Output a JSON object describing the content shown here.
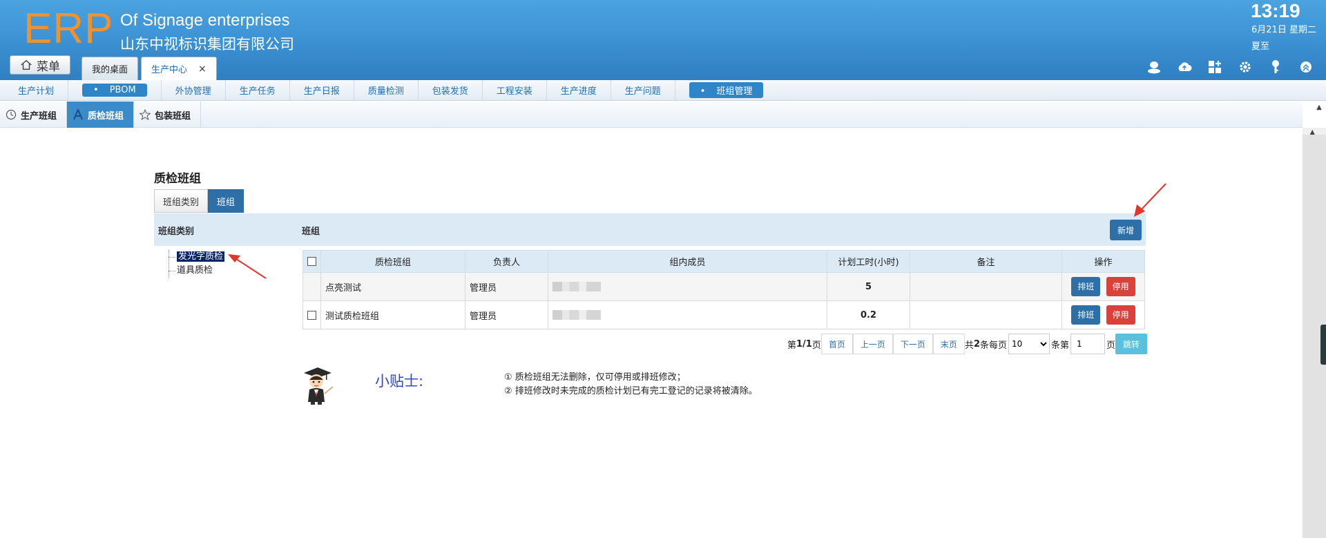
{
  "header": {
    "logo": "ERP",
    "company_en": "Of Signage enterprises",
    "company_cn": "山东中视标识集团有限公司",
    "time": "13:19",
    "date": "6月21日 星期二",
    "solar_term": "夏至"
  },
  "menu_button": {
    "label": "菜单",
    "icon": "home-icon"
  },
  "tabs": [
    {
      "label": "我的桌面",
      "active": false
    },
    {
      "label": "生产中心",
      "active": true,
      "closable": true,
      "close_glyph": "×"
    }
  ],
  "tool_icons": [
    "user-icon",
    "cloud-upload-icon",
    "grid-add-icon",
    "gear-icon",
    "key-icon",
    "collapse-up-icon"
  ],
  "module_nav": [
    {
      "label": "生产计划",
      "active": false
    },
    {
      "label": "PBOM",
      "active": true
    },
    {
      "label": "外协管理",
      "active": false
    },
    {
      "label": "生产任务",
      "active": false
    },
    {
      "label": "生产日报",
      "active": false
    },
    {
      "label": "质量检测",
      "active": false
    },
    {
      "label": "包装发货",
      "active": false
    },
    {
      "label": "工程安装",
      "active": false
    },
    {
      "label": "生产进度",
      "active": false
    },
    {
      "label": "生产问题",
      "active": false
    },
    {
      "label": "班组管理",
      "active": true
    }
  ],
  "sub_nav": [
    {
      "label": "生产班组",
      "icon": "clock-icon",
      "active": false
    },
    {
      "label": "质检班组",
      "icon": "a-letter-icon",
      "active": true
    },
    {
      "label": "包装班组",
      "icon": "star-icon",
      "active": false
    }
  ],
  "page": {
    "title": "质检班组",
    "view_tabs": [
      {
        "label": "班组类别",
        "active": false
      },
      {
        "label": "班组",
        "active": true
      }
    ],
    "left_header": "班组类别",
    "right_header": "班组",
    "add_button": "新增"
  },
  "tree": [
    {
      "label": "发光字质检",
      "selected": true
    },
    {
      "label": "道具质检",
      "selected": false
    }
  ],
  "table": {
    "columns": [
      "质检班组",
      "负责人",
      "组内成员",
      "计划工时(小时)",
      "备注",
      "操作"
    ],
    "rows": [
      {
        "name": "点亮测试",
        "leader": "管理员",
        "hours": "5",
        "remark": ""
      },
      {
        "name": "测试质检班组",
        "leader": "管理员",
        "hours": "0.2",
        "remark": ""
      }
    ],
    "row_actions": {
      "schedule": "排班",
      "disable": "停用"
    }
  },
  "pager": {
    "page_prefix": "第",
    "page_info": "1/1",
    "page_suffix": "页",
    "first": "首页",
    "prev": "上一页",
    "next": "下一页",
    "last": "末页",
    "total_prefix": "共",
    "total": "2",
    "total_suffix": "条每页",
    "page_size": "10",
    "goto_prefix": "条第",
    "goto_value": "1",
    "goto_suffix": "页",
    "go_button": "跳转"
  },
  "tips": {
    "title": "小贴士:",
    "items": [
      "① 质检班组无法删除，仅可停用或排班修改；",
      "② 排班修改时未完成的质检计划已有完工登记的记录将被清除。"
    ]
  },
  "colors": {
    "header_blue": "#3b90d2",
    "logo_orange": "#f0922f",
    "primary_button": "#2e6fa8",
    "danger_button": "#d9413b",
    "tip_title": "#3347c6",
    "annotation_red": "#e8332a"
  }
}
